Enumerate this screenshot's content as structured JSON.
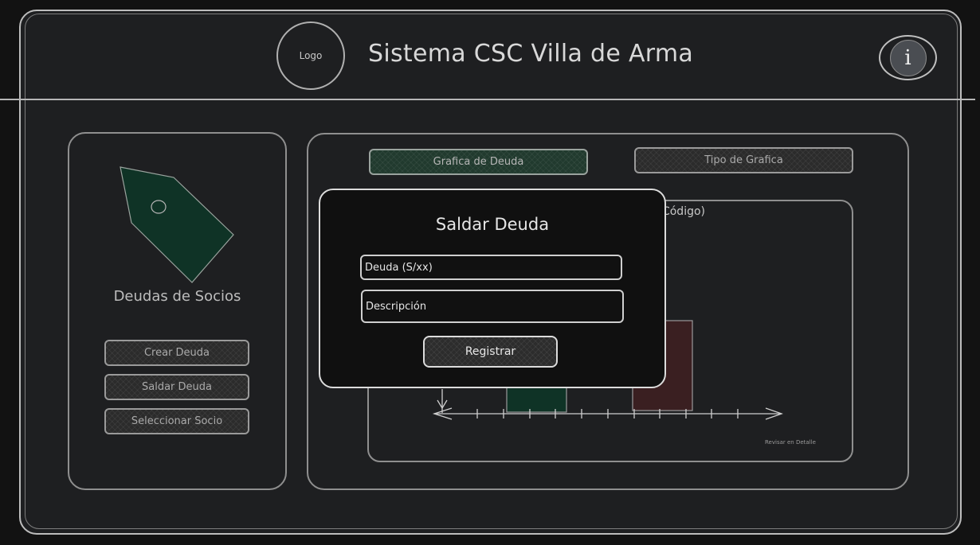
{
  "header": {
    "logo_label": "Logo",
    "app_title": "Sistema CSC Villa de Arma",
    "info_glyph": "i",
    "info_icon": "info-icon"
  },
  "sidebar": {
    "icon": "tag-icon",
    "title": "Deudas de Socios",
    "buttons": [
      {
        "label": "Crear Deuda"
      },
      {
        "label": "Saldar Deuda"
      },
      {
        "label": "Seleccionar Socio"
      }
    ]
  },
  "main": {
    "tab_graph": "Grafica de Deuda",
    "tab_type": "Tipo de Grafica",
    "chart_title": "Código)",
    "chart_footnote": "Revisar en Detalle"
  },
  "modal": {
    "title": "Saldar Deuda",
    "debt_field_value": "Deuda (S/xx)",
    "description_field_value": "Descripción",
    "submit_label": "Registrar"
  },
  "colors": {
    "background": "#121212",
    "panel": "#1e1f21",
    "accent_green": "#0f3326",
    "accent_red": "#3a1f21"
  }
}
